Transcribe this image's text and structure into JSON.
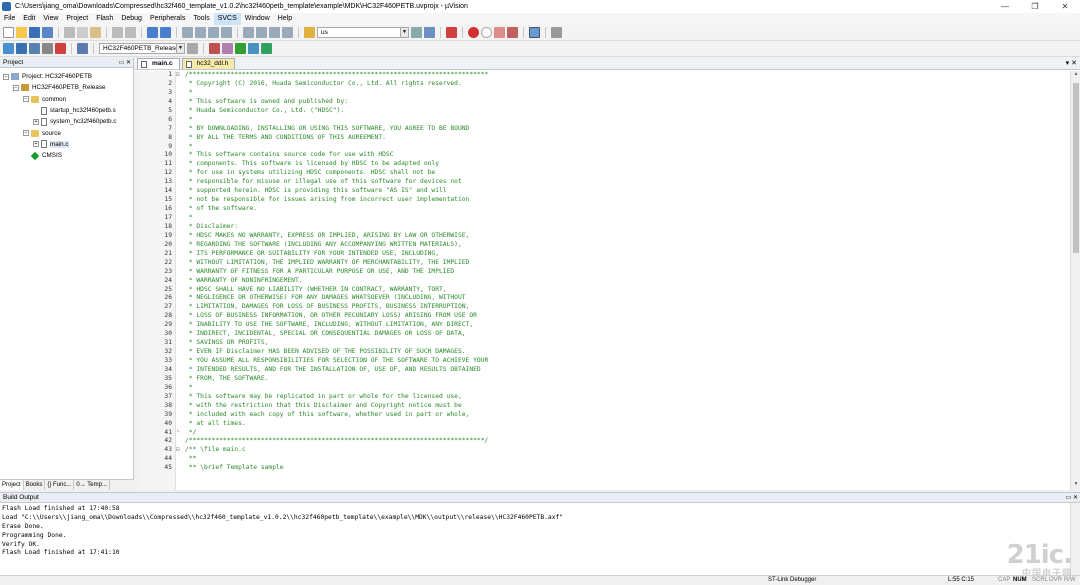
{
  "window": {
    "title": "C:\\Users\\jiang_oma\\Downloads\\Compressed\\hc32f460_template_v1.0.2\\hc32f460petb_template\\example\\MDK\\HC32F460PETB.uvprojx - µVision",
    "minimize": "—",
    "maximize": "❐",
    "close": "✕"
  },
  "menu": [
    "File",
    "Edit",
    "View",
    "Project",
    "Flash",
    "Debug",
    "Peripherals",
    "Tools",
    "SVCS",
    "Window",
    "Help"
  ],
  "toolbar": {
    "find_value": "us",
    "target_select": "HC32F460PETB_Release"
  },
  "project_panel": {
    "header": "Project",
    "items": [
      {
        "label": "Project: HC32F460PETB",
        "level": 0,
        "expander": "−"
      },
      {
        "label": "HC32F460PETB_Release",
        "level": 1,
        "expander": "−"
      },
      {
        "label": "common",
        "level": 2,
        "expander": "−"
      },
      {
        "label": "startup_hc32f460petb.s",
        "level": 3,
        "expander": ""
      },
      {
        "label": "system_hc32f460petb.c",
        "level": 3,
        "expander": "+"
      },
      {
        "label": "source",
        "level": 2,
        "expander": "−"
      },
      {
        "label": "main.c",
        "level": 3,
        "expander": "+"
      },
      {
        "label": "CMSIS",
        "level": 2,
        "expander": ""
      }
    ],
    "tabs": [
      "Project",
      "Books",
      "{} Func...",
      "0→ Temp..."
    ]
  },
  "editor": {
    "tabs": [
      {
        "label": "main.c",
        "active": true
      },
      {
        "label": "hc32_ddl.h",
        "active": false
      }
    ],
    "lines": [
      "/*******************************************************************************",
      " * Copyright (C) 2016, Huada Semiconductor Co., Ltd. All rights reserved.",
      " *",
      " * This software is owned and published by:",
      " * Huada Semiconductor Co., Ltd. (\"HDSC\").",
      " *",
      " * BY DOWNLOADING, INSTALLING OR USING THIS SOFTWARE, YOU AGREE TO BE BOUND",
      " * BY ALL THE TERMS AND CONDITIONS OF THIS AGREEMENT.",
      " *",
      " * This software contains source code for use with HDSC",
      " * components. This software is licensed by HDSC to be adapted only",
      " * for use in systems utilizing HDSC components. HDSC shall not be",
      " * responsible for misuse or illegal use of this software for devices not",
      " * supported herein. HDSC is providing this software \"AS IS\" and will",
      " * not be responsible for issues arising from incorrect user implementation",
      " * of the software.",
      " *",
      " * Disclaimer:",
      " * HDSC MAKES NO WARRANTY, EXPRESS OR IMPLIED, ARISING BY LAW OR OTHERWISE,",
      " * REGARDING THE SOFTWARE (INCLUDING ANY ACCOMPANYING WRITTEN MATERIALS),",
      " * ITS PERFORMANCE OR SUITABILITY FOR YOUR INTENDED USE, INCLUDING,",
      " * WITHOUT LIMITATION, THE IMPLIED WARRANTY OF MERCHANTABILITY, THE IMPLIED",
      " * WARRANTY OF FITNESS FOR A PARTICULAR PURPOSE OR USE, AND THE IMPLIED",
      " * WARRANTY OF NONINFRINGEMENT.",
      " * HDSC SHALL HAVE NO LIABILITY (WHETHER IN CONTRACT, WARRANTY, TORT,",
      " * NEGLIGENCE OR OTHERWISE) FOR ANY DAMAGES WHATSOEVER (INCLUDING, WITHOUT",
      " * LIMITATION, DAMAGES FOR LOSS OF BUSINESS PROFITS, BUSINESS INTERRUPTION,",
      " * LOSS OF BUSINESS INFORMATION, OR OTHER PECUNIARY LOSS) ARISING FROM USE OR",
      " * INABILITY TO USE THE SOFTWARE, INCLUDING, WITHOUT LIMITATION, ANY DIRECT,",
      " * INDIRECT, INCIDENTAL, SPECIAL OR CONSEQUENTIAL DAMAGES OR LOSS OF DATA,",
      " * SAVINGS OR PROFITS,",
      " * EVEN IF Disclaimer HAS BEEN ADVISED OF THE POSSIBILITY OF SUCH DAMAGES.",
      " * YOU ASSUME ALL RESPONSIBILITIES FOR SELECTION OF THE SOFTWARE TO ACHIEVE YOUR",
      " * INTENDED RESULTS, AND FOR THE INSTALLATION OF, USE OF, AND RESULTS OBTAINED",
      " * FROM, THE SOFTWARE.",
      " *",
      " * This software may be replicated in part or whole for the licensed use,",
      " * with the restriction that this Disclaimer and Copyright notice must be",
      " * included with each copy of this software, whether used in part or whole,",
      " * at all times.",
      " */",
      "/******************************************************************************/",
      "/** \\file main.c",
      " **",
      " ** \\brief Template sample"
    ],
    "fold_marks": {
      "1": "⊟",
      "41": "└",
      "43": "⊟"
    }
  },
  "build_output": {
    "header": "Build Output",
    "lines": [
      "Flash Load finished at 17:40:58",
      "Load \"C:\\\\Users\\\\jiang_oma\\\\Downloads\\\\Compressed\\\\hc32f460_template_v1.0.2\\\\hc32f460petb_template\\\\example\\\\MDK\\\\output\\\\release\\\\HC32F460PETB.axf\"",
      "Erase Done.",
      "Programming Done.",
      "Verify OK.",
      "Flash Load finished at 17:41:10"
    ]
  },
  "status": {
    "debugger": "ST-Link Debugger",
    "position": "L:55 C:15",
    "caps": "CAP",
    "num": "NUM",
    "scrl": "SCRL",
    "ovr": "OVR",
    "rw": "R/W"
  },
  "watermark": {
    "text": "21ic.",
    "sub": "中国电子网"
  }
}
